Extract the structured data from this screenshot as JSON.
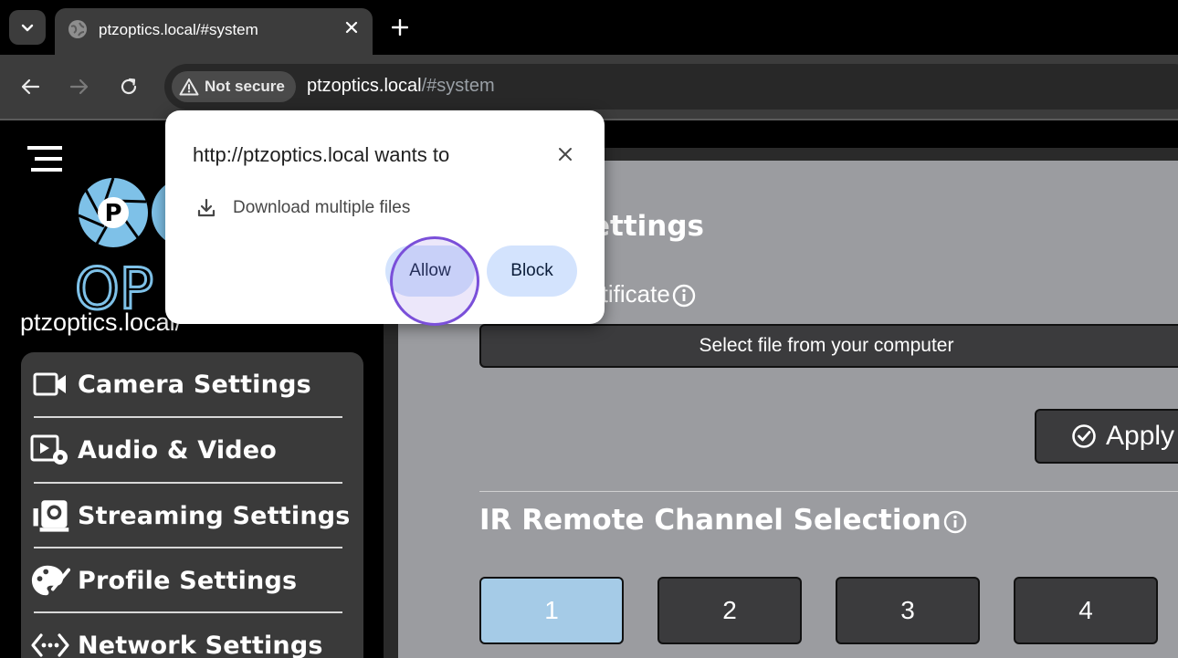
{
  "browser": {
    "tab": {
      "title": "ptzoptics.local/#system",
      "favicon": "globe-icon"
    },
    "toolbar": {
      "security_label": "Not secure",
      "url_host": "ptzoptics.local",
      "url_path": "/#system"
    }
  },
  "permission_popup": {
    "title": "http://ptzoptics.local wants to",
    "request": "Download multiple files",
    "allow_label": "Allow",
    "block_label": "Block"
  },
  "site": {
    "name": "ptzoptics.local/",
    "logo_letters": "P OP"
  },
  "sidebar": {
    "items": [
      {
        "label": "Camera Settings",
        "icon": "video-camera-icon"
      },
      {
        "label": "Audio & Video",
        "icon": "audio-video-settings-icon"
      },
      {
        "label": "Streaming Settings",
        "icon": "streaming-camera-icon"
      },
      {
        "label": "Profile Settings",
        "icon": "palette-icon"
      },
      {
        "label": "Network Settings",
        "icon": "network-icon"
      }
    ]
  },
  "main": {
    "section_title_partial": "ettings",
    "certificate_label_partial": "rtificate",
    "file_button_label": "Select file from your computer",
    "apply_label": "Apply",
    "ir_title": "IR Remote Channel Selection",
    "channels": [
      "1",
      "2",
      "3",
      "4"
    ],
    "selected_channel": "1"
  },
  "colors": {
    "accent_blue": "#a5cbe7",
    "popup_button": "#d3e3fd",
    "panel_gray": "#9b9ca0",
    "click_ring": "#7a4fd9"
  }
}
